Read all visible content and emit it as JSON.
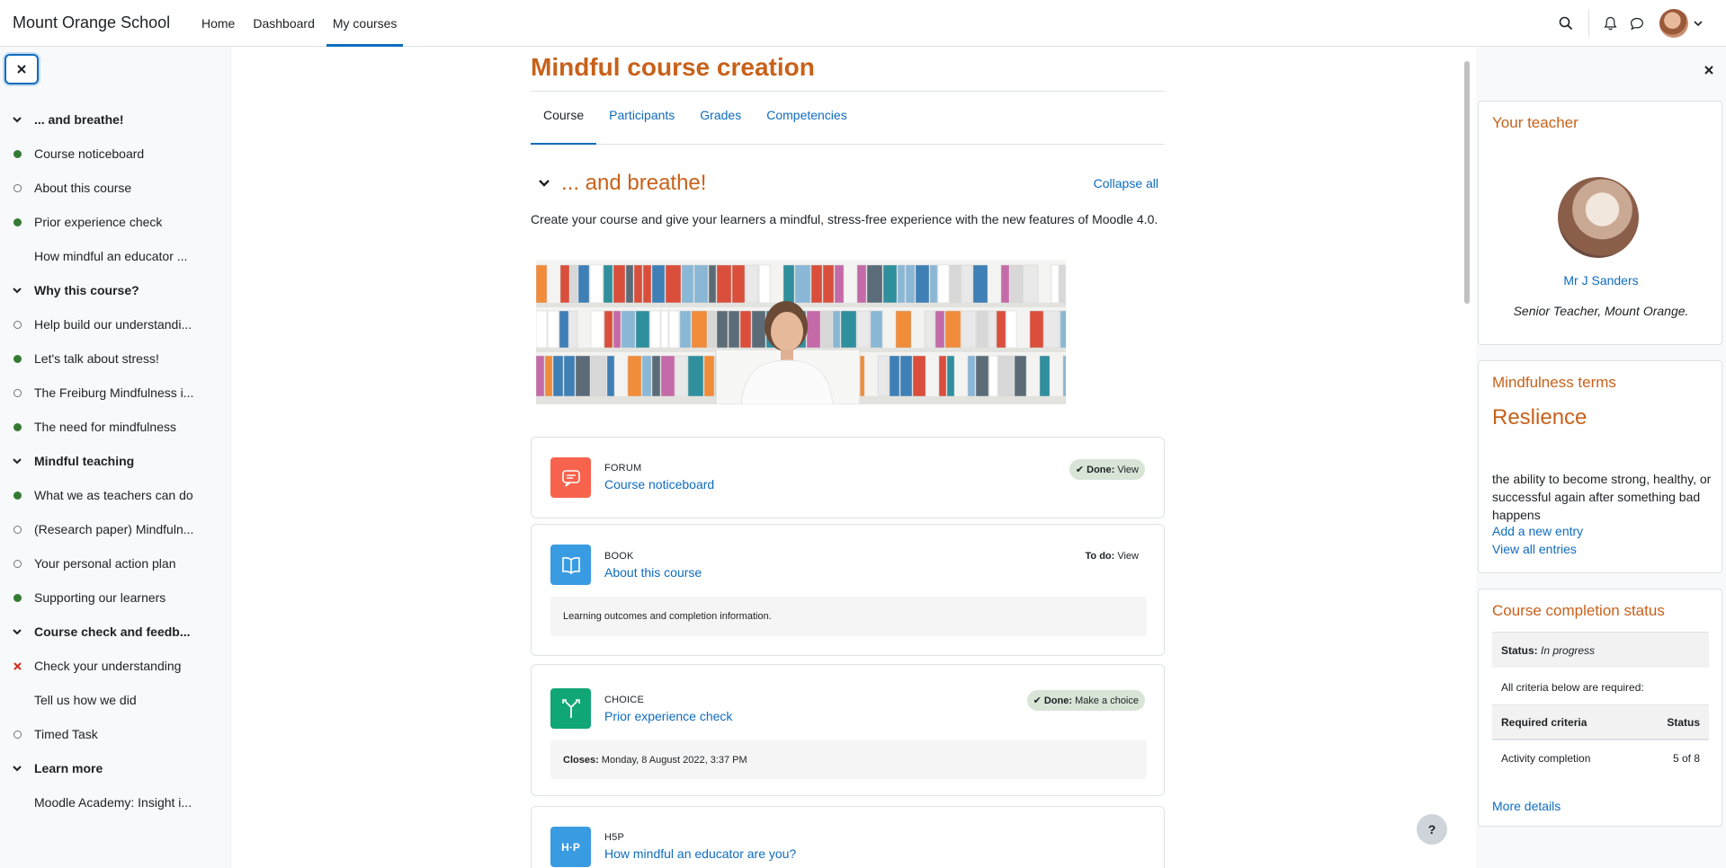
{
  "header": {
    "site_name": "Mount Orange School",
    "nav": [
      {
        "label": "Home",
        "active": false
      },
      {
        "label": "Dashboard",
        "active": false
      },
      {
        "label": "My courses",
        "active": true
      }
    ],
    "icons": [
      "search-icon",
      "bell-icon",
      "chat-icon",
      "avatar",
      "chevron-down-icon"
    ]
  },
  "course_index": {
    "items": [
      {
        "label": "... and breathe!",
        "type": "section"
      },
      {
        "label": "Course noticeboard",
        "type": "activity",
        "status": "done"
      },
      {
        "label": "About this course",
        "type": "activity",
        "status": "todo"
      },
      {
        "label": "Prior experience check",
        "type": "activity",
        "status": "done"
      },
      {
        "label": "How mindful an educator ...",
        "type": "activity",
        "status": "none"
      },
      {
        "label": "Why this course?",
        "type": "section"
      },
      {
        "label": "Help build our understandi...",
        "type": "activity",
        "status": "todo"
      },
      {
        "label": "Let's talk about stress!",
        "type": "activity",
        "status": "done"
      },
      {
        "label": "The Freiburg Mindfulness i...",
        "type": "activity",
        "status": "todo"
      },
      {
        "label": "The need for mindfulness",
        "type": "activity",
        "status": "done"
      },
      {
        "label": "Mindful teaching",
        "type": "section"
      },
      {
        "label": "What we as teachers can do",
        "type": "activity",
        "status": "done"
      },
      {
        "label": "(Research paper) Mindfuln...",
        "type": "activity",
        "status": "todo"
      },
      {
        "label": "Your personal action plan",
        "type": "activity",
        "status": "todo"
      },
      {
        "label": "Supporting our learners",
        "type": "activity",
        "status": "done"
      },
      {
        "label": "Course check and feedb...",
        "type": "section"
      },
      {
        "label": "Check your understanding",
        "type": "activity",
        "status": "failed"
      },
      {
        "label": "Tell us how we did",
        "type": "activity",
        "status": "none"
      },
      {
        "label": "Timed Task",
        "type": "activity",
        "status": "todo"
      },
      {
        "label": "Learn more",
        "type": "section"
      },
      {
        "label": "Moodle Academy: Insight i...",
        "type": "activity",
        "status": "none"
      }
    ]
  },
  "main": {
    "title": "Mindful course creation",
    "tabs": [
      "Course",
      "Participants",
      "Grades",
      "Competencies"
    ],
    "section": {
      "title": "... and breathe!",
      "collapse_all": "Collapse all",
      "summary": "Create your course and give your learners a mindful, stress-free experience with the new features of Moodle 4.0."
    },
    "activities": [
      {
        "type": "FORUM",
        "name": "Course noticeboard",
        "badge_strong": "Done:",
        "badge_text": " View",
        "badge_state": "done",
        "color": "#f7634d"
      },
      {
        "type": "BOOK",
        "name": "About this course",
        "badge_strong": "To do:",
        "badge_text": " View",
        "badge_state": "todo",
        "info": "Learning outcomes and completion information.",
        "color": "#399be2"
      },
      {
        "type": "CHOICE",
        "name": "Prior experience check",
        "badge_strong": "Done:",
        "badge_text": " Make a choice",
        "badge_state": "done",
        "info_strong": "Closes:",
        "info_text": " Monday, 8 August 2022, 3:37 PM",
        "color": "#11a676"
      },
      {
        "type": "H5P",
        "name": "How mindful an educator are you?",
        "color": "#399be2"
      }
    ]
  },
  "right_blocks": {
    "teacher": {
      "title": "Your teacher",
      "name": "Mr J Sanders",
      "role": "Senior Teacher, Mount Orange."
    },
    "terms": {
      "title": "Mindfulness terms",
      "word": "Reslience",
      "definition": "the ability to become strong, healthy, or successful again after something bad happens",
      "add_link": "Add a new entry",
      "view_link": "View all entries"
    },
    "completion": {
      "title": "Course completion status",
      "status_label": "Status:",
      "status_value": "In progress",
      "required_note": "All criteria below are required:",
      "col_criteria": "Required criteria",
      "col_status": "Status",
      "row_criteria": "Activity completion",
      "row_status": "5 of 8",
      "more": "More details"
    }
  },
  "help_label": "?"
}
